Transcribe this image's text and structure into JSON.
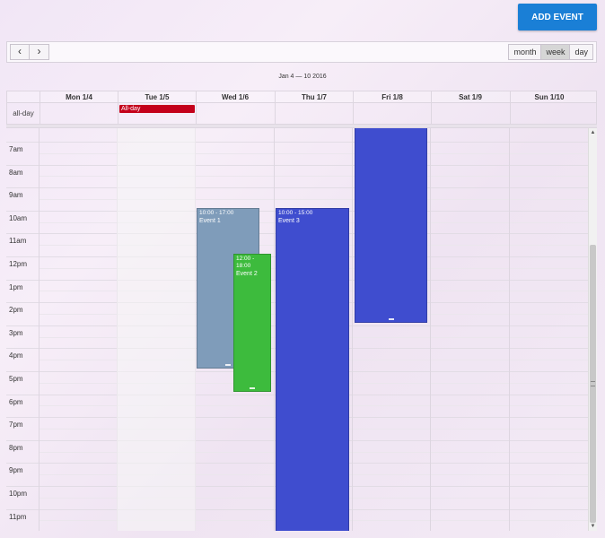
{
  "add_button": "ADD EVENT",
  "nav": {
    "prev": "‹",
    "next": "›"
  },
  "views": [
    "month",
    "week",
    "day"
  ],
  "active_view": "week",
  "range_title": "Jan 4 — 10 2016",
  "days": [
    "Mon 1/4",
    "Tue 1/5",
    "Wed 1/6",
    "Thu 1/7",
    "Fri 1/8",
    "Sat 1/9",
    "Sun 1/10"
  ],
  "allday_label": "all-day",
  "allday_event": {
    "title": "All-day",
    "color": "#c4001b"
  },
  "hours": [
    "7am",
    "8am",
    "9am",
    "10am",
    "11am",
    "12pm",
    "1pm",
    "2pm",
    "3pm",
    "4pm",
    "5pm",
    "6pm",
    "7pm",
    "8pm",
    "9pm",
    "10pm",
    "11pm"
  ],
  "events": [
    {
      "time": "10:00 - 17:00",
      "title": "Event 1",
      "color": "#7f9cba"
    },
    {
      "time": "12:00 - 18:00",
      "title": "Event 2",
      "color": "#3dbb3d"
    },
    {
      "time": "10:00 - 15:00",
      "title": "Event 3",
      "color": "#3f4dcf"
    },
    {
      "time": "",
      "title": "",
      "color": "#3f4dcf"
    }
  ]
}
